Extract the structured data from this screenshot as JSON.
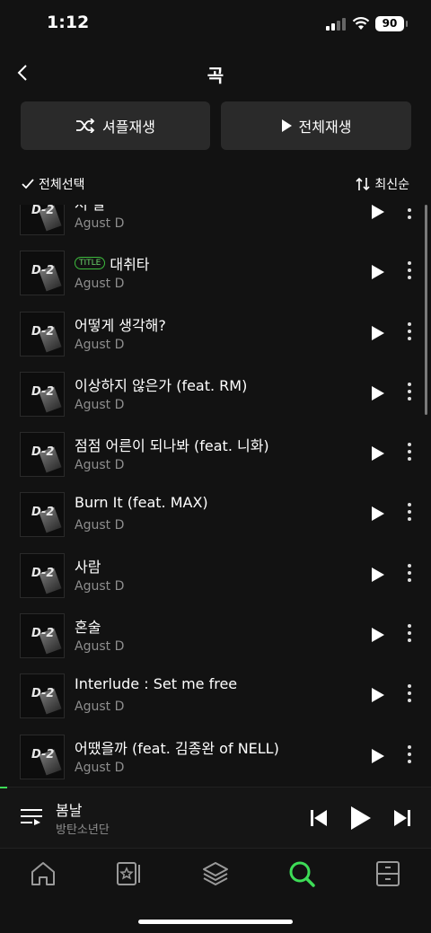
{
  "status": {
    "time": "1:12",
    "battery": "90"
  },
  "header": {
    "title": "곡"
  },
  "actions": {
    "shuffle_label": "셔플재생",
    "play_all_label": "전체재생"
  },
  "controls": {
    "select_all_label": "전체선택",
    "sort_label": "최신순"
  },
  "tracks": [
    {
      "title": "저 팔",
      "artist": "Agust D",
      "badge": ""
    },
    {
      "title": "대취타",
      "artist": "Agust D",
      "badge": "TITLE"
    },
    {
      "title": "어떻게 생각해?",
      "artist": "Agust D",
      "badge": ""
    },
    {
      "title": "이상하지 않은가 (feat. RM)",
      "artist": "Agust D",
      "badge": ""
    },
    {
      "title": "점점 어른이 되나봐 (feat. 니화)",
      "artist": "Agust D",
      "badge": ""
    },
    {
      "title": "Burn It (feat. MAX)",
      "artist": "Agust D",
      "badge": ""
    },
    {
      "title": "사람",
      "artist": "Agust D",
      "badge": ""
    },
    {
      "title": "혼술",
      "artist": "Agust D",
      "badge": ""
    },
    {
      "title": "Interlude : Set me free",
      "artist": "Agust D",
      "badge": ""
    },
    {
      "title": "어땠을까 (feat. 김종완 of NELL)",
      "artist": "Agust D",
      "badge": ""
    }
  ],
  "album_art_text": "D-2",
  "now_playing": {
    "title": "봄날",
    "artist": "방탄소년단"
  },
  "nav": {
    "active_color": "#3ddc57",
    "items": [
      {
        "icon": "home-icon"
      },
      {
        "icon": "library-card-icon"
      },
      {
        "icon": "layers-icon"
      },
      {
        "icon": "search-icon"
      },
      {
        "icon": "storage-box-icon"
      }
    ]
  }
}
